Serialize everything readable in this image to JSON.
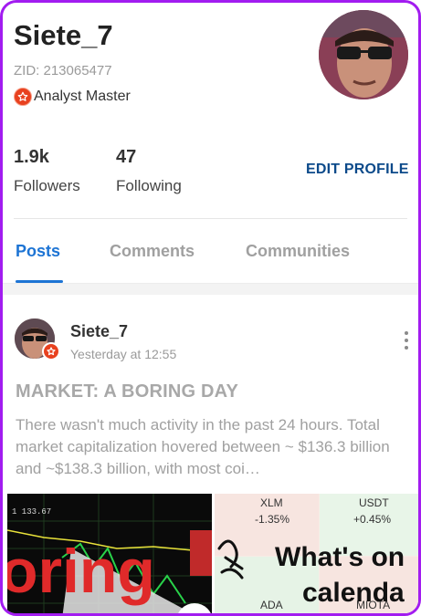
{
  "profile": {
    "username": "Siete_7",
    "zid": "ZID: 213065477",
    "badge_label": "Analyst Master",
    "followers_count": "1.9k",
    "followers_label": "Followers",
    "following_count": "47",
    "following_label": "Following",
    "edit_button": "EDIT PROFILE"
  },
  "tabs": [
    {
      "label": "Posts",
      "active": true
    },
    {
      "label": "Comments",
      "active": false
    },
    {
      "label": "Communities",
      "active": false
    }
  ],
  "post": {
    "author": "Siete_7",
    "time": "Yesterday at 12:55",
    "title": "MARKET: A BORING DAY",
    "body": "There wasn't much activity in the past 24 hours. Total market capitalization hovered between ~ $136.3 billion and ~$138.3 billion, with most coi…",
    "image_left": {
      "price_label": "1 133.67",
      "overlay_text": "oring"
    },
    "image_right": {
      "headline_line1": "What's on",
      "headline_line2": "calenda",
      "tiles": [
        {
          "symbol": "XLM",
          "change": "-1.35%"
        },
        {
          "symbol": "USDT",
          "change": "+0.45%"
        },
        {
          "symbol": "ADA",
          "change": ""
        },
        {
          "symbol": "MIOTA",
          "change": ""
        }
      ]
    }
  },
  "colors": {
    "frame_border": "#a21cf0",
    "accent_blue": "#1d74d4",
    "edit_profile_blue": "#0c4a8a",
    "badge_red": "#e8411f"
  },
  "icons": {
    "badge": "star-badge-icon",
    "more": "more-vertical-icon"
  }
}
